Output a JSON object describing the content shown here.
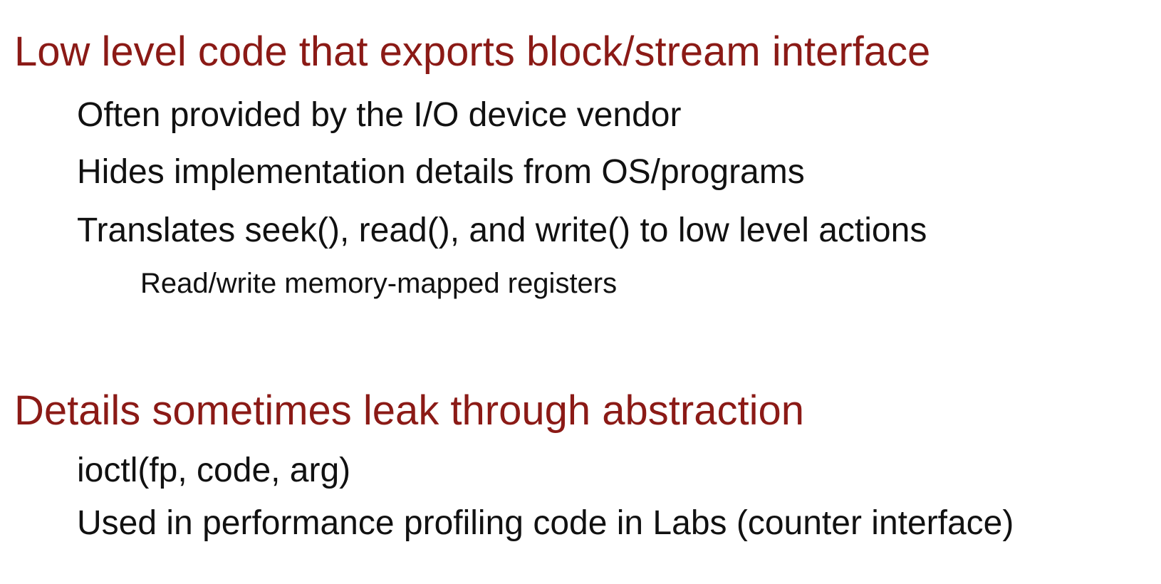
{
  "sections": [
    {
      "heading": "Low level code that exports block/stream interface",
      "items": [
        "Often provided by the I/O device vendor",
        "Hides implementation details from OS/programs",
        "Translates seek(), read(), and write() to low level actions"
      ],
      "subitems": [
        "Read/write memory-mapped registers"
      ]
    },
    {
      "heading": "Details sometimes leak through abstraction",
      "items": [
        "ioctl(fp, code, arg)",
        "Used in performance profiling code in Labs (counter interface)"
      ]
    }
  ],
  "colors": {
    "heading": "#8b1a16",
    "body_text": "#111111",
    "background": "#ffffff"
  }
}
